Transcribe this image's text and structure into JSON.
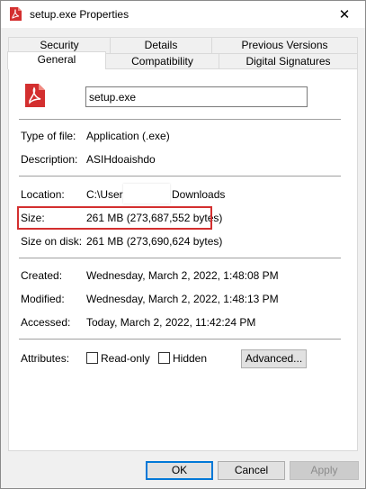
{
  "window": {
    "title": "setup.exe Properties",
    "close_glyph": "✕",
    "title_icon": "pdf-file-icon",
    "accent_color": "#d32f2f"
  },
  "tabs": {
    "row1": [
      "Security",
      "Details",
      "Previous Versions"
    ],
    "row2": [
      "General",
      "Compatibility",
      "Digital Signatures"
    ],
    "selected": "General"
  },
  "general": {
    "file_name": "setup.exe",
    "fields": {
      "type_label": "Type of file:",
      "type_value": "Application (.exe)",
      "description_label": "Description:",
      "description_value": "ASIHdoaishdo",
      "location_label": "Location:",
      "location_value_start": "C:\\Users",
      "location_value_end": "Downloads",
      "size_label": "Size:",
      "size_value": "261 MB (273,687,552 bytes)",
      "size_on_disk_label": "Size on disk:",
      "size_on_disk_value": "261 MB (273,690,624 bytes)",
      "created_label": "Created:",
      "created_value": "Wednesday, March 2, 2022, 1:48:08 PM",
      "modified_label": "Modified:",
      "modified_value": "Wednesday, March 2, 2022, 1:48:13 PM",
      "accessed_label": "Accessed:",
      "accessed_value": "Today, March 2, 2022, 11:42:24 PM"
    },
    "attributes": {
      "label": "Attributes:",
      "read_only_label": "Read-only",
      "read_only_checked": false,
      "hidden_label": "Hidden",
      "hidden_checked": false,
      "advanced_button": "Advanced..."
    }
  },
  "buttons": {
    "ok": "OK",
    "cancel": "Cancel",
    "apply": "Apply"
  }
}
